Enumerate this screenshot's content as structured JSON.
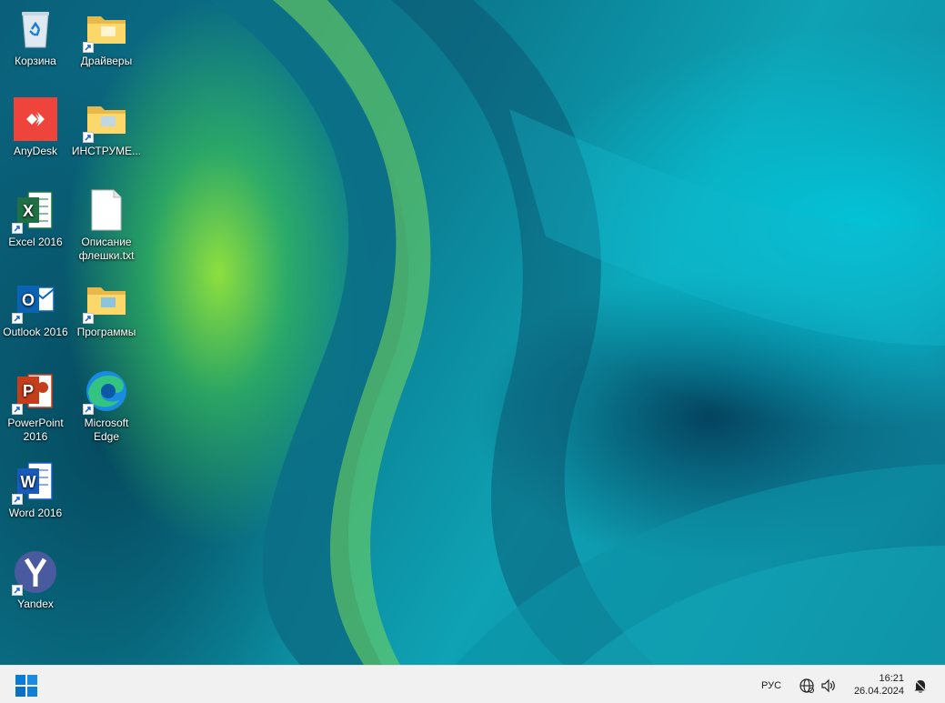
{
  "desktop": {
    "icons": [
      {
        "label": "Корзина",
        "icon": "recycle-bin-icon"
      },
      {
        "label": "Драйверы",
        "icon": "folder-shortcut-icon"
      },
      {
        "label": "AnyDesk",
        "icon": "anydesk-icon"
      },
      {
        "label": "ИНСТРУМЕ...",
        "icon": "folder-shortcut-icon"
      },
      {
        "label": "Excel 2016",
        "icon": "excel-icon"
      },
      {
        "label": "Описание\nфлешки.txt",
        "icon": "text-file-icon"
      },
      {
        "label": "Outlook 2016",
        "icon": "outlook-icon"
      },
      {
        "label": "Программы",
        "icon": "folder-shortcut-icon"
      },
      {
        "label": "PowerPoint\n2016",
        "icon": "powerpoint-icon"
      },
      {
        "label": "Microsoft\nEdge",
        "icon": "edge-icon"
      },
      {
        "label": "Word 2016",
        "icon": "word-icon"
      },
      {
        "label": "Yandex",
        "icon": "yandex-browser-icon"
      }
    ]
  },
  "taskbar": {
    "start_icon": "windows-start-icon",
    "language": "РУС",
    "tray_icons": [
      "network-globe-icon",
      "volume-icon",
      "notification-bell-icon"
    ],
    "time": "16:21",
    "date": "26.04.2024"
  },
  "colors": {
    "taskbar_bg": "#f1f1f1",
    "accent": "#0078d4"
  }
}
